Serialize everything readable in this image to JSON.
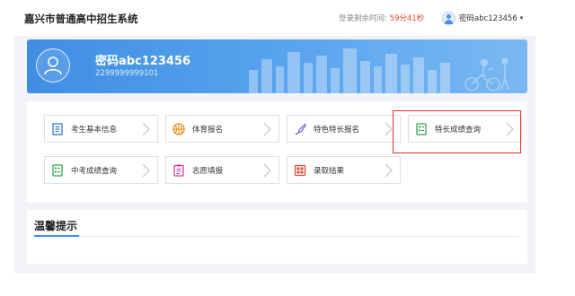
{
  "header": {
    "app_title": "嘉兴市普通高中招生系统",
    "session_label": "登录剩余时间:",
    "session_time": "59分41秒",
    "user_name": "密码abc123456",
    "caret": "▾"
  },
  "banner": {
    "name": "密码abc123456",
    "id_number": "2299999999101"
  },
  "menu": {
    "items": [
      {
        "label": "考生基本信息",
        "icon": "student-info-icon"
      },
      {
        "label": "体育报名",
        "icon": "basketball-icon"
      },
      {
        "label": "特色特长报名",
        "icon": "brush-icon"
      },
      {
        "label": "特长成绩查询",
        "icon": "score-query-icon"
      },
      {
        "label": "中考成绩查询",
        "icon": "score-query-icon"
      },
      {
        "label": "志愿填报",
        "icon": "checklist-icon"
      },
      {
        "label": "录取结果",
        "icon": "admission-icon"
      }
    ],
    "highlighted_item": "特长成绩查询"
  },
  "tips": {
    "title": "温馨提示"
  },
  "colors": {
    "accent_blue": "#3f8ee3",
    "highlight_red": "#e52f2f",
    "session_red": "#e94335",
    "icon_green": "#2fa84f",
    "icon_orange": "#f08c1a",
    "icon_purple": "#7b5fd6",
    "icon_magenta": "#d63c9c",
    "icon_red": "#e24b3b",
    "icon_blue": "#2f7de1"
  }
}
